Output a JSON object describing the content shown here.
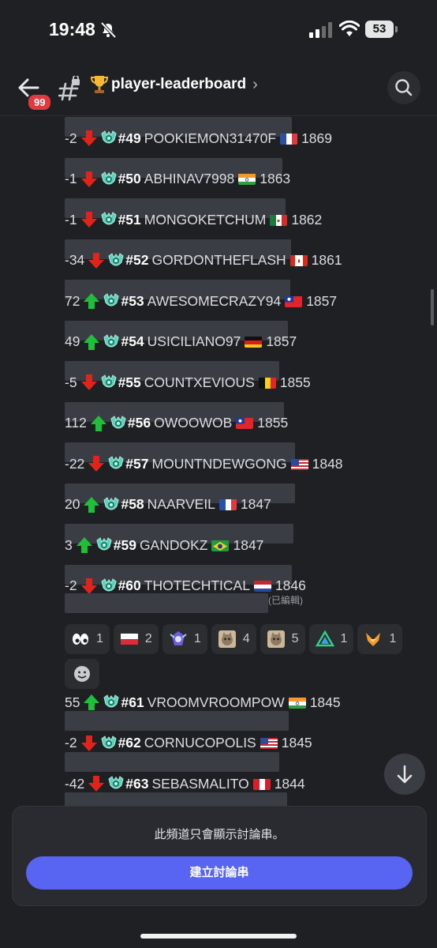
{
  "status": {
    "time": "19:48",
    "battery": "53"
  },
  "header": {
    "unread_badge": "99",
    "channel_name": "player-leaderboard",
    "chevron": "›"
  },
  "entries": [
    {
      "delta": "-2",
      "dir": "down",
      "rank": "#49",
      "name": "POOKIEMON31470F",
      "flag": "fr",
      "score": "1869"
    },
    {
      "delta": "-1",
      "dir": "down",
      "rank": "#50",
      "name": "ABHINAV7998",
      "flag": "in",
      "score": "1863"
    },
    {
      "delta": "-1",
      "dir": "down",
      "rank": "#51",
      "name": "MONGOKETCHUM",
      "flag": "mx",
      "score": "1862"
    },
    {
      "delta": "-34",
      "dir": "down",
      "rank": "#52",
      "name": "GORDONTHEFLASH",
      "flag": "ca",
      "score": "1861"
    },
    {
      "delta": "72",
      "dir": "up",
      "rank": "#53",
      "name": "AWESOMECRAZY94",
      "flag": "tw",
      "score": "1857"
    },
    {
      "delta": "49",
      "dir": "up",
      "rank": "#54",
      "name": "USICILIANO97",
      "flag": "de",
      "score": "1857"
    },
    {
      "delta": "-5",
      "dir": "down",
      "rank": "#55",
      "name": "COUNTXEVIOUS",
      "flag": "be",
      "score": "1855"
    },
    {
      "delta": "112",
      "dir": "up",
      "rank": "#56",
      "name": "OWOOWOB",
      "flag": "tw",
      "score": "1855"
    },
    {
      "delta": "-22",
      "dir": "down",
      "rank": "#57",
      "name": "MOUNTNDEWGONG",
      "flag": "us",
      "score": "1848"
    },
    {
      "delta": "20",
      "dir": "up",
      "rank": "#58",
      "name": "NAARVEIL",
      "flag": "fr",
      "score": "1847"
    },
    {
      "delta": "3",
      "dir": "up",
      "rank": "#59",
      "name": "GANDOKZ",
      "flag": "br",
      "score": "1847"
    },
    {
      "delta": "-2",
      "dir": "down",
      "rank": "#60",
      "name": "THOTECHTICAL",
      "flag": "nl",
      "score": "1846"
    }
  ],
  "edited_label": "(已編輯)",
  "reactions": [
    {
      "emoji": "eyes-emoji",
      "count": "1"
    },
    {
      "emoji": "poland-flag-emoji",
      "count": "2"
    },
    {
      "emoji": "mage-emoji",
      "count": "1"
    },
    {
      "emoji": "cat-emoji",
      "count": "4"
    },
    {
      "emoji": "cat-emoji",
      "count": "5"
    },
    {
      "emoji": "triangle-emoji",
      "count": "1"
    },
    {
      "emoji": "fox-emoji",
      "count": "1"
    }
  ],
  "entries2": [
    {
      "delta": "55",
      "dir": "up",
      "rank": "#61",
      "name": "VROOMVROOMPOW",
      "flag": "in",
      "score": "1845"
    },
    {
      "delta": "-2",
      "dir": "down",
      "rank": "#62",
      "name": "CORNUCOPOLIS",
      "flag": "us",
      "score": "1845"
    },
    {
      "delta": "-42",
      "dir": "down",
      "rank": "#63",
      "name": "SEBASMALITO",
      "flag": "pe",
      "score": "1844"
    }
  ],
  "thread_notice": "此頻道只會顯示討論串。",
  "create_thread": "建立討論串",
  "colors": {
    "accent": "#5865f2",
    "up": "#1fbf3a",
    "down": "#e0241b",
    "badge": "#e1393f"
  }
}
